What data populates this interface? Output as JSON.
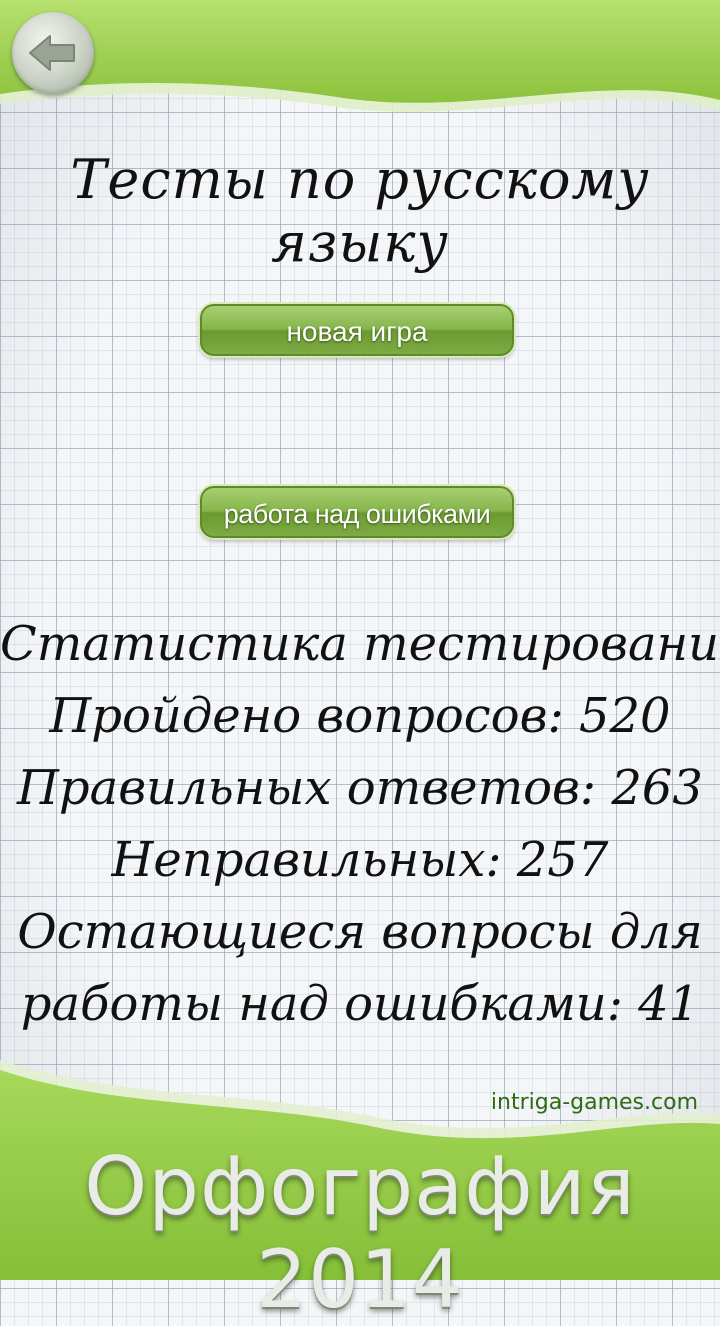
{
  "header": {
    "back_icon": "back-arrow-icon"
  },
  "main": {
    "title": "Тесты по русскому языку",
    "new_game_label": "новая игра",
    "errors_label": "работа над ошибками"
  },
  "stats": {
    "heading": "Статистика тестирования",
    "questions_passed": "Пройдено вопросов: 520",
    "correct_answers": "Правильных ответов: 263",
    "incorrect_answers": "Неправильных: 257",
    "remaining_line1": "Остающиеся вопросы для",
    "remaining_line2": "работы над ошибками: 41"
  },
  "footer": {
    "site": "intriga-games.com",
    "app_title": "Орфография 2014"
  },
  "colors": {
    "accent_green": "#86b54a",
    "bar_green": "#9ccf4e"
  }
}
